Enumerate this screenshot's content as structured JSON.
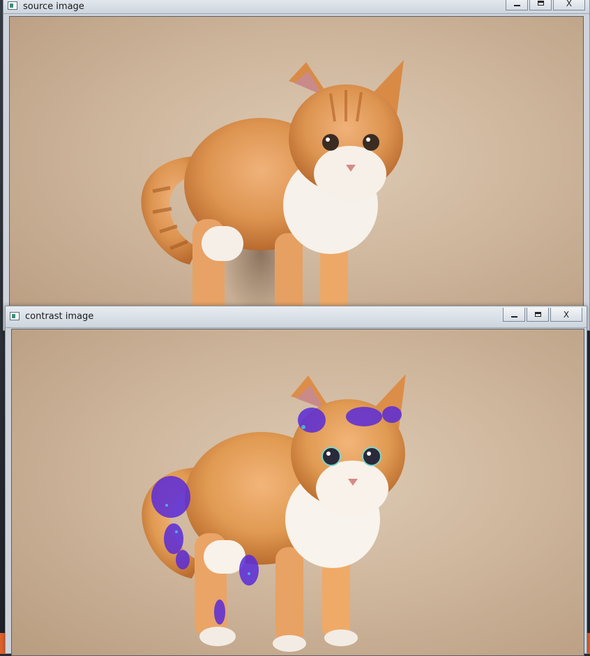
{
  "windows": [
    {
      "title": "source image",
      "controls": {
        "minimize": "minimize",
        "maximize": "maximize",
        "close": "X"
      },
      "image": {
        "subject": "kitten",
        "variant": "source"
      }
    },
    {
      "title": "contrast image",
      "controls": {
        "minimize": "minimize",
        "maximize": "maximize",
        "close": "X"
      },
      "image": {
        "subject": "kitten",
        "variant": "contrast-enhanced",
        "artifact_color": "#5a2bd9"
      }
    }
  ],
  "icons": {
    "app": "opencv-window-icon",
    "minimize": "minimize-icon",
    "maximize": "maximize-icon",
    "close": "close-icon"
  }
}
